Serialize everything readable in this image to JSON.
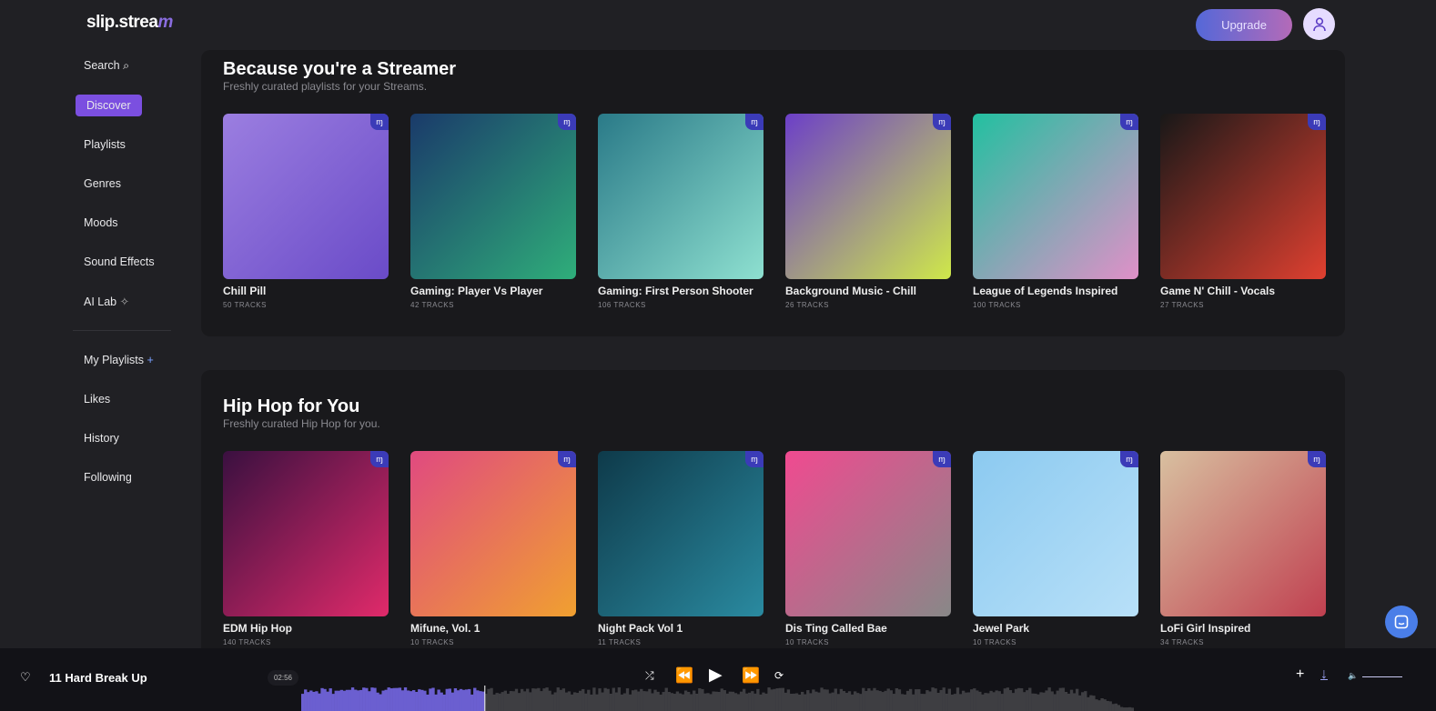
{
  "header": {
    "logo": "slip.stream",
    "upgrade_label": "Upgrade"
  },
  "sidebar": {
    "items": [
      {
        "label": "Search"
      },
      {
        "label": "Discover"
      },
      {
        "label": "Playlists"
      },
      {
        "label": "Genres"
      },
      {
        "label": "Moods"
      },
      {
        "label": "Sound Effects"
      },
      {
        "label": "AI Lab"
      }
    ],
    "library": [
      {
        "label": "My Playlists"
      },
      {
        "label": "Likes"
      },
      {
        "label": "History"
      },
      {
        "label": "Following"
      }
    ]
  },
  "sections": [
    {
      "title": "Because you're a Streamer",
      "subtitle": "Freshly curated playlists for your Streams.",
      "cards": [
        {
          "title": "Chill Pill",
          "count": "50 TRACKS",
          "colors": [
            "#9b7ee0",
            "#6a4bc8"
          ]
        },
        {
          "title": "Gaming: Player Vs Player",
          "count": "42 TRACKS",
          "colors": [
            "#1a3a6a",
            "#2fae7a"
          ]
        },
        {
          "title": "Gaming: First Person Shooter",
          "count": "106 TRACKS",
          "colors": [
            "#2a7a88",
            "#8ee0d0"
          ]
        },
        {
          "title": "Background Music - Chill",
          "count": "26 TRACKS",
          "colors": [
            "#6c3fc8",
            "#cfe84a"
          ]
        },
        {
          "title": "League of Legends Inspired",
          "count": "100 TRACKS",
          "colors": [
            "#22c0a0",
            "#e090c8"
          ]
        },
        {
          "title": "Game N' Chill - Vocals",
          "count": "27 TRACKS",
          "colors": [
            "#181818",
            "#e04030"
          ]
        }
      ]
    },
    {
      "title": "Hip Hop for You",
      "subtitle": "Freshly curated Hip Hop for you.",
      "cards": [
        {
          "title": "EDM Hip Hop",
          "count": "140 TRACKS",
          "colors": [
            "#3a1040",
            "#e02a6a"
          ]
        },
        {
          "title": "Mifune, Vol. 1",
          "count": "10 TRACKS",
          "colors": [
            "#e04a80",
            "#f0a030"
          ]
        },
        {
          "title": "Night Pack Vol 1",
          "count": "11 TRACKS",
          "colors": [
            "#0e3a4a",
            "#2a8aa0"
          ]
        },
        {
          "title": "Dis Ting Called Bae",
          "count": "10 TRACKS",
          "colors": [
            "#f04a90",
            "#888888"
          ]
        },
        {
          "title": "Jewel Park",
          "count": "10 TRACKS",
          "colors": [
            "#8ccaf0",
            "#b8e0f8"
          ]
        },
        {
          "title": "LoFi Girl Inspired",
          "count": "34 TRACKS",
          "colors": [
            "#d8c0a0",
            "#c04050"
          ]
        }
      ]
    }
  ],
  "player": {
    "track": "11 Hard Break Up",
    "time": "02:56",
    "progress": 0.22,
    "accent": "#6b5fd0"
  }
}
